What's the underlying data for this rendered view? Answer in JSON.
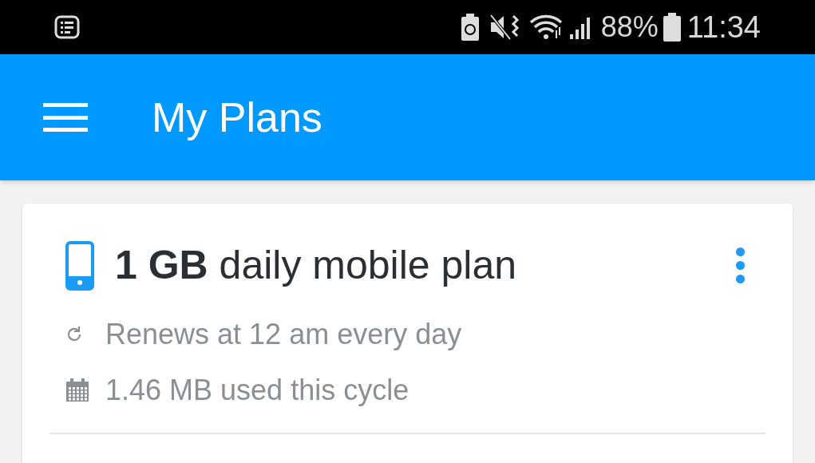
{
  "status_bar": {
    "battery": "88%",
    "time": "11:34"
  },
  "app_bar": {
    "title": "My Plans"
  },
  "plan": {
    "title": "**1 GB** daily mobile plan",
    "details": [
      {
        "kind": "renew",
        "text": "Renews at 12 am every day"
      },
      {
        "kind": "usage",
        "text": "1.46 MB used this cycle"
      }
    ]
  }
}
